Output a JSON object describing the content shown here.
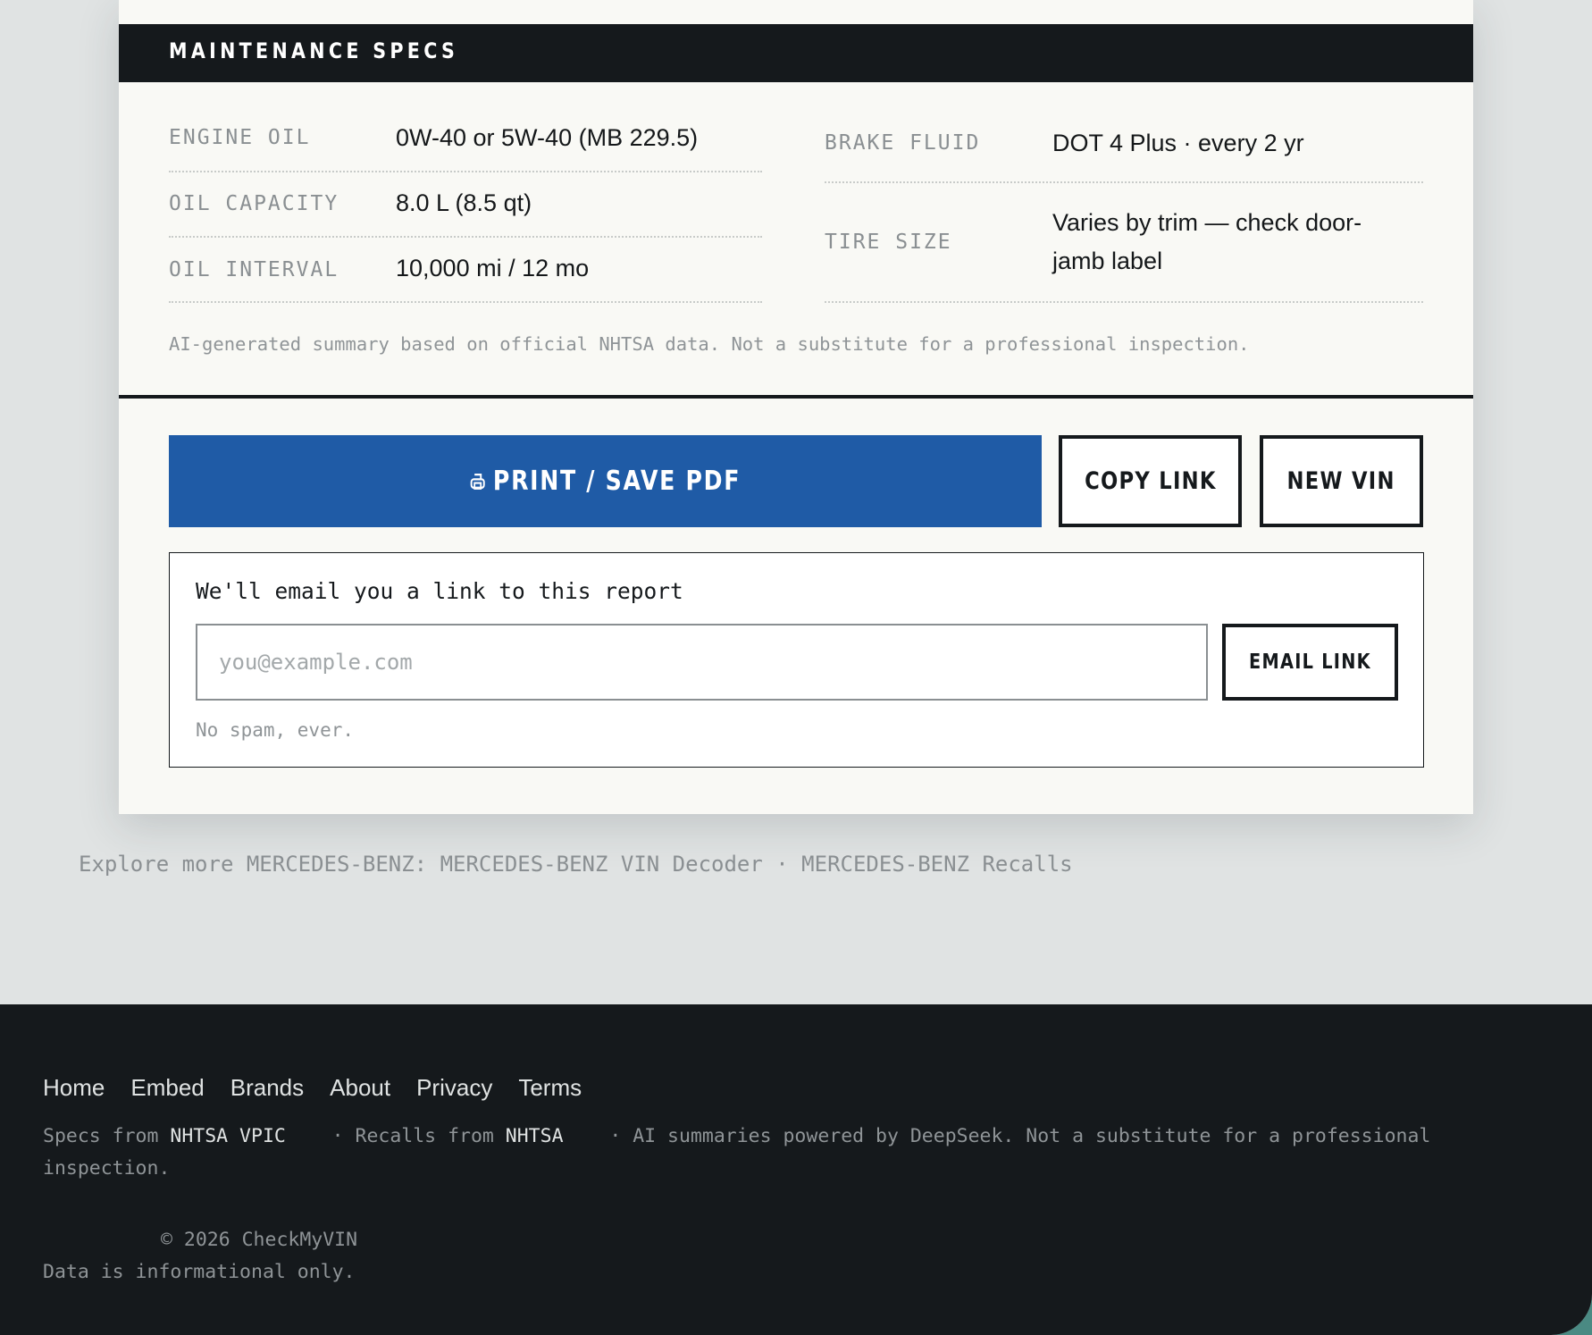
{
  "maintenance": {
    "title": "MAINTENANCE SPECS",
    "left_specs": [
      {
        "label": "ENGINE OIL",
        "value": "0W-40 or 5W-40 (MB 229.5)"
      },
      {
        "label": "OIL CAPACITY",
        "value": "8.0 L (8.5 qt)"
      },
      {
        "label": "OIL INTERVAL",
        "value": "10,000 mi / 12 mo"
      }
    ],
    "right_specs": [
      {
        "label": "BRAKE FLUID",
        "value": "DOT 4 Plus · every 2 yr"
      },
      {
        "label": "TIRE SIZE",
        "value": "Varies by trim — check door-jamb label"
      }
    ],
    "disclaimer": "AI-generated summary based on official NHTSA data. Not a substitute for a professional inspection."
  },
  "actions": {
    "print_label": "PRINT / SAVE PDF",
    "print_icon": "print-icon",
    "copy_link_label": "COPY LINK",
    "new_vin_label": "NEW VIN"
  },
  "email": {
    "heading": "We'll email you a link to this report",
    "placeholder": "you@example.com",
    "value": "",
    "button_label": "EMAIL LINK",
    "note": "No spam, ever."
  },
  "explore": {
    "prefix": "Explore more MERCEDES-BENZ: ",
    "decoder_link": "MERCEDES-BENZ VIN Decoder",
    "separator": " · ",
    "recalls_link": "MERCEDES-BENZ Recalls"
  },
  "footer": {
    "nav": [
      "Home",
      "Embed",
      "Brands",
      "About",
      "Privacy",
      "Terms"
    ],
    "sources": {
      "specs_prefix": "Specs from ",
      "specs_link": "NHTSA VPIC",
      "recalls_prefix": " · Recalls from ",
      "recalls_link": "NHTSA",
      "ai_note": " · AI summaries powered by DeepSeek. Not a substitute for a professional inspection."
    },
    "copyright": "© 2026 CheckMyVIN",
    "data_note": "Data is informational only."
  },
  "colors": {
    "accent": "#1f5ba6",
    "ink": "#15191c",
    "card_bg": "#f9f9f5",
    "page_bg": "#e0e3e3"
  }
}
